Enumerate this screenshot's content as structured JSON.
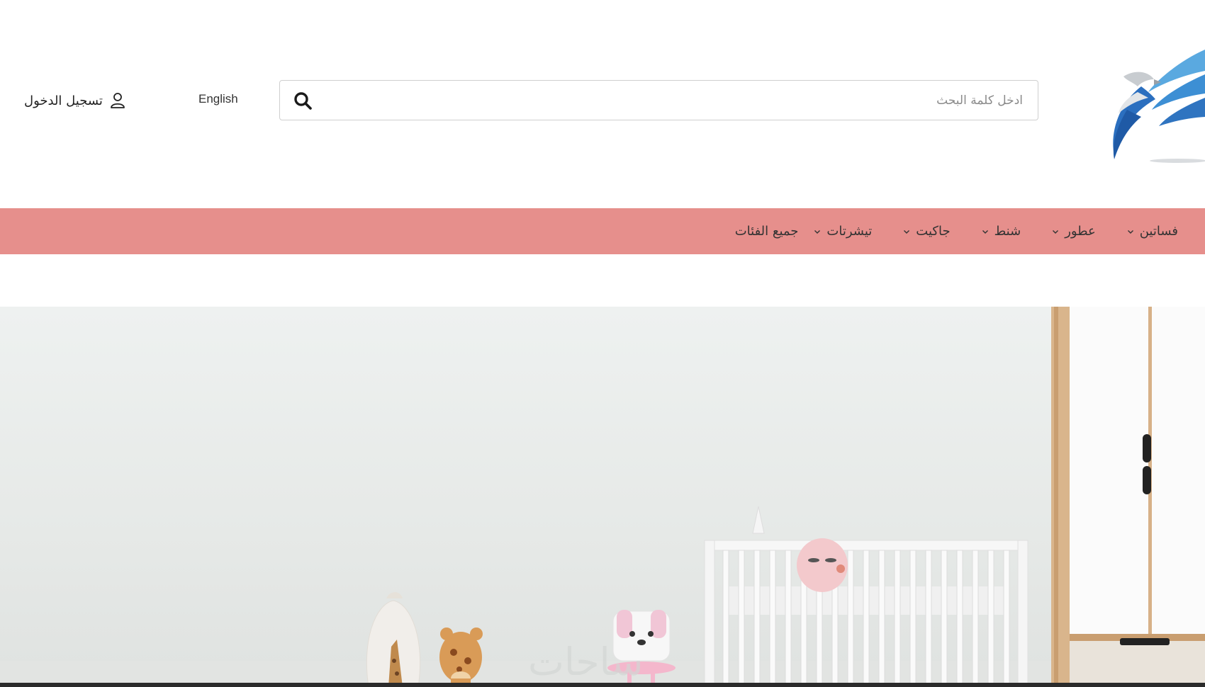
{
  "header": {
    "search": {
      "placeholder": "ادخل كلمة البحث",
      "icon": "search-icon"
    },
    "language_link": "English",
    "login": {
      "label": "تسجيل الدخول",
      "icon": "user-icon"
    },
    "logo_icon": "eagle-logo-icon"
  },
  "nav": {
    "background": "#e68f8c",
    "items": [
      {
        "label": "جميع الفئات",
        "has_dropdown": false
      },
      {
        "label": "تيشرتات",
        "has_dropdown": true
      },
      {
        "label": "جاكيت",
        "has_dropdown": true
      },
      {
        "label": "شنط",
        "has_dropdown": true
      },
      {
        "label": "عطور",
        "has_dropdown": true
      },
      {
        "label": "فساتين",
        "has_dropdown": true
      }
    ]
  },
  "hero": {
    "image": "nursery-room-banner"
  },
  "colors": {
    "accent": "#e68f8c",
    "logo_blue": "#2f74c0",
    "logo_light_blue": "#5aa9e0"
  }
}
